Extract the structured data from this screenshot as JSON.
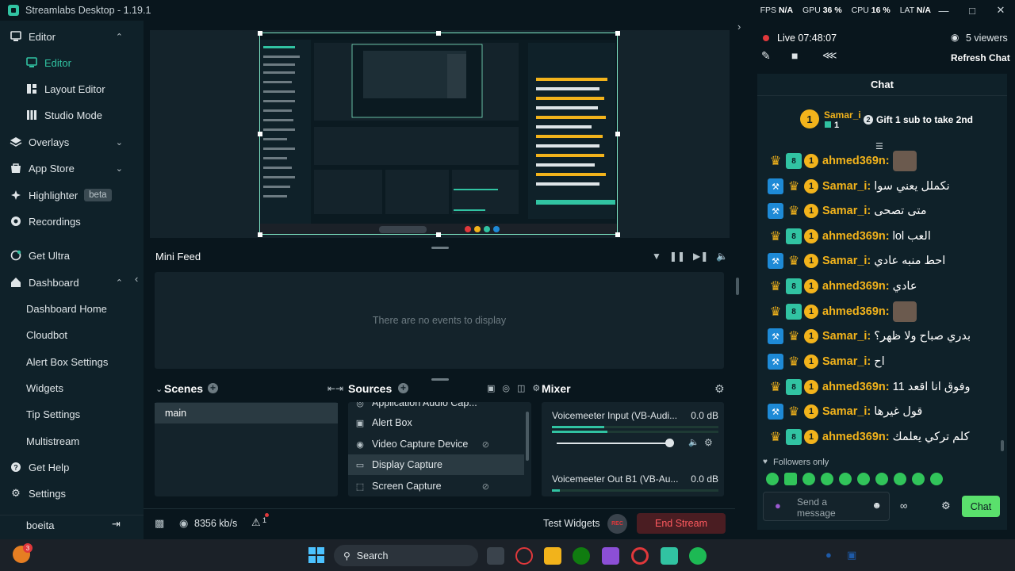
{
  "app": {
    "title": "Streamlabs Desktop - 1.19.1"
  },
  "stats": {
    "fps_label": "FPS",
    "fps_value": "N/A",
    "gpu_label": "GPU",
    "gpu_value": "36 %",
    "cpu_label": "CPU",
    "cpu_value": "16 %",
    "lat_label": "LAT",
    "lat_value": "N/A"
  },
  "sidebar": {
    "items": [
      {
        "label": "Editor",
        "icon": "editor-icon",
        "chevron": "up"
      },
      {
        "label": "Editor",
        "icon": "editor-icon",
        "active": true
      },
      {
        "label": "Layout Editor",
        "icon": "layout-icon"
      },
      {
        "label": "Studio Mode",
        "icon": "studio-icon"
      },
      {
        "label": "Overlays",
        "icon": "overlays-icon",
        "chevron": "down"
      },
      {
        "label": "App Store",
        "icon": "store-icon",
        "chevron": "down"
      },
      {
        "label": "Highlighter",
        "icon": "highlighter-icon",
        "badge": "beta"
      },
      {
        "label": "Recordings",
        "icon": "recordings-icon"
      },
      {
        "label": "Get Ultra",
        "icon": "ultra-icon"
      },
      {
        "label": "Dashboard",
        "icon": "dashboard-icon",
        "chevron": "up"
      },
      {
        "label": "Dashboard Home"
      },
      {
        "label": "Cloudbot"
      },
      {
        "label": "Alert Box Settings"
      },
      {
        "label": "Widgets"
      },
      {
        "label": "Tip Settings"
      },
      {
        "label": "Multistream"
      },
      {
        "label": "Get Help",
        "icon": "help-icon"
      },
      {
        "label": "Settings",
        "icon": "gear-icon"
      }
    ],
    "user": "boeita"
  },
  "minifeed": {
    "title": "Mini Feed",
    "empty": "There are no events to display"
  },
  "scenes": {
    "title": "Scenes",
    "items": [
      "main"
    ]
  },
  "sources": {
    "title": "Sources",
    "items": [
      "Application Audio Cap...",
      "Alert Box",
      "Video Capture Device",
      "Display Capture",
      "Screen Capture"
    ]
  },
  "mixer": {
    "title": "Mixer",
    "channels": [
      {
        "name": "Voicemeeter Input (VB-Audi...",
        "level": "0.0 dB"
      },
      {
        "name": "Voicemeeter Out B1 (VB-Au...",
        "level": "0.0 dB"
      }
    ]
  },
  "footer": {
    "bitrate": "8356 kb/s",
    "alert_count": "1",
    "test_widgets": "Test Widgets",
    "rec": "REC",
    "end_stream": "End Stream"
  },
  "live": {
    "status": "Live 07:48:07",
    "viewers": "5 viewers",
    "refresh": "Refresh Chat"
  },
  "chat": {
    "title": "Chat",
    "top_user": "Samar_i",
    "top_count": "1",
    "gift_number": "2",
    "gift_text": "Gift 1 sub to take 2nd",
    "messages": [
      {
        "user": "ahmed369n:",
        "text": "",
        "emote": true,
        "badge": "crown"
      },
      {
        "user": "Samar_i:",
        "text": "نكملل يعني سوا",
        "badge": "wrench"
      },
      {
        "user": "Samar_i:",
        "text": "متى تصحى",
        "badge": "wrench"
      },
      {
        "user": "ahmed369n:",
        "text": "lol العب",
        "badge": "crown"
      },
      {
        "user": "Samar_i:",
        "text": "احط منبه عادي",
        "badge": "wrench"
      },
      {
        "user": "ahmed369n:",
        "text": "عادي",
        "badge": "crown"
      },
      {
        "user": "ahmed369n:",
        "text": "",
        "emote": true,
        "badge": "crown"
      },
      {
        "user": "Samar_i:",
        "text": "بدري صباح ولا ظهر؟",
        "badge": "wrench"
      },
      {
        "user": "Samar_i:",
        "text": "اح",
        "badge": "wrench"
      },
      {
        "user": "ahmed369n:",
        "text": "وفوق انا اقعد 11",
        "badge": "crown"
      },
      {
        "user": "Samar_i:",
        "text": "قول غيرها",
        "badge": "wrench"
      },
      {
        "user": "ahmed369n:",
        "text": "كلم تركي يعلمك",
        "badge": "crown"
      }
    ],
    "followers_only": "Followers only",
    "placeholder": "Send a message",
    "send": "Chat"
  },
  "taskbar": {
    "search": "Search",
    "notification_count": "3"
  },
  "colors": {
    "accent": "#31c3a2",
    "live_red": "#e0383b",
    "end_stream_bg": "#4a1d22"
  }
}
